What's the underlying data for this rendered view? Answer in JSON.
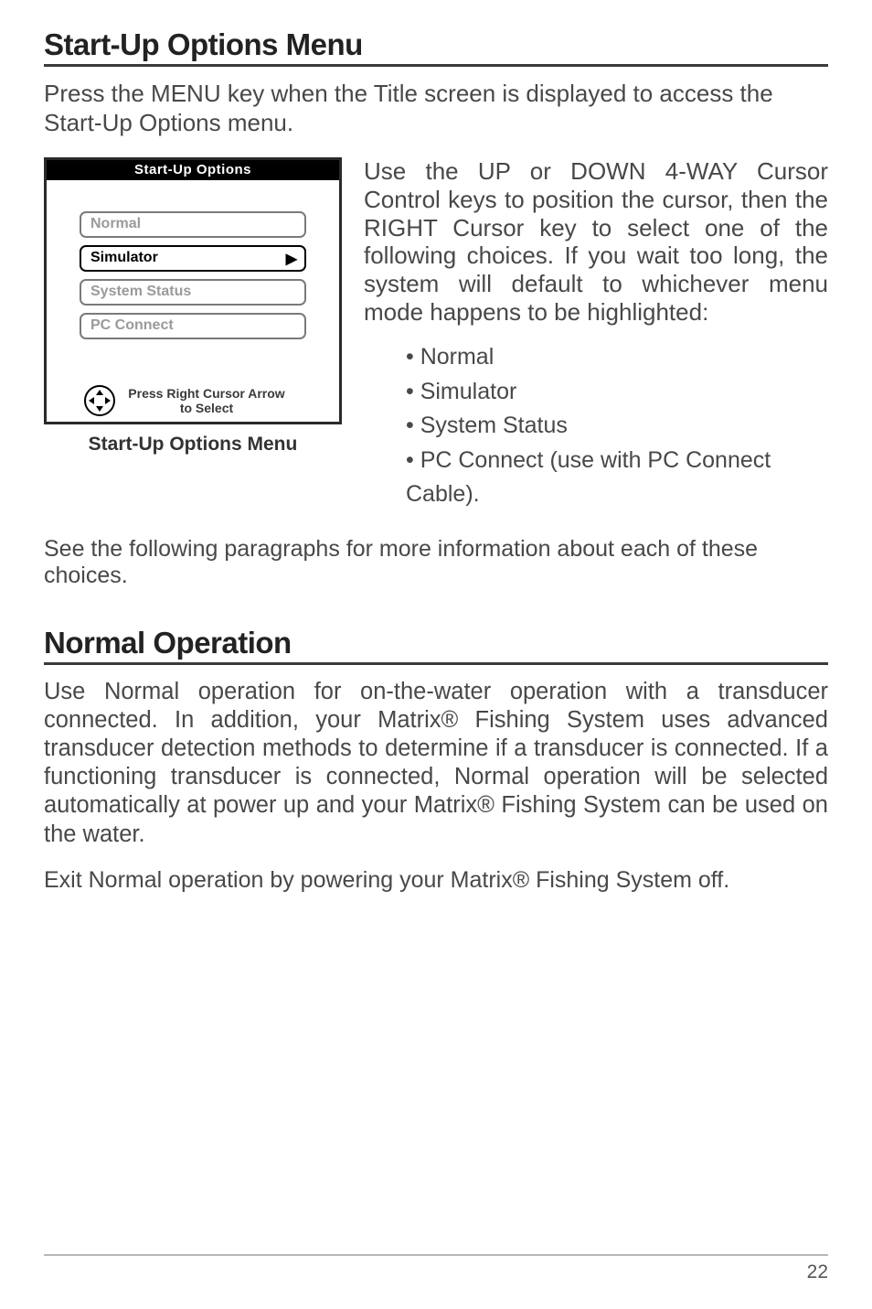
{
  "heading1": "Start-Up Options Menu",
  "intro": "Press the MENU key when the Title screen is displayed to access the Start-Up Options menu.",
  "lcd": {
    "title": "Start-Up Options",
    "opts": {
      "normal": "Normal",
      "simulator": "Simulator",
      "system_status": "System Status",
      "pc_connect": "PC Connect"
    },
    "footer_line1": "Press Right Cursor Arrow",
    "footer_line2": "to Select"
  },
  "caption": "Start-Up Options Menu",
  "right_para": "Use the UP or DOWN 4-WAY Cursor Control keys to position the cursor, then the RIGHT Cursor key to select one of the following choices. If you wait too long, the system will default to whichever menu mode happens to be highlighted:",
  "bullets": {
    "b1": "Normal",
    "b2": "Simulator",
    "b3": "System Status",
    "b4": "PC Connect (use with PC Connect Cable)."
  },
  "followup": "See the following paragraphs for more information about each of these choices.",
  "heading2": "Normal Operation",
  "body2": "Use Normal operation for on-the-water operation with a transducer connected. In addition, your Matrix® Fishing System uses advanced transducer detection methods to determine if a transducer is connected. If a functioning transducer is connected, Normal operation will be selected automatically at power up and your Matrix® Fishing System can be used on the water.",
  "exit": "Exit Normal operation by powering your Matrix® Fishing System off.",
  "page_number": "22"
}
